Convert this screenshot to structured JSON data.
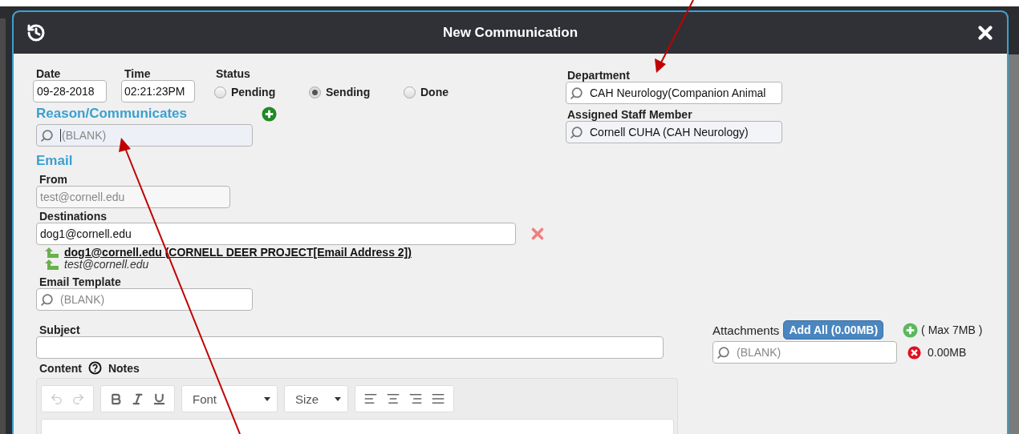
{
  "dialog": {
    "title": "New Communication"
  },
  "date": {
    "label": "Date",
    "value": "09-28-2018"
  },
  "time": {
    "label": "Time",
    "value": "02:21:23PM"
  },
  "status": {
    "label": "Status",
    "options": [
      {
        "label": "Pending",
        "selected": false
      },
      {
        "label": "Sending",
        "selected": true
      },
      {
        "label": "Done",
        "selected": false
      }
    ]
  },
  "reason": {
    "heading": "Reason/Communicates",
    "placeholder": "(BLANK)",
    "focused": true
  },
  "email": {
    "heading": "Email",
    "from": {
      "label": "From",
      "value": "test@cornell.edu",
      "disabled": true
    },
    "destinations": {
      "label": "Destinations",
      "value": "dog1@cornell.edu",
      "suggestions": [
        {
          "text": "dog1@cornell.edu (CORNELL DEER PROJECT[Email Address 2])",
          "kind": "link"
        },
        {
          "text": "test@cornell.edu",
          "kind": "plain"
        }
      ]
    },
    "template": {
      "label": "Email Template",
      "placeholder": "(BLANK)"
    }
  },
  "department": {
    "label": "Department",
    "value": "CAH Neurology(Companion Animal"
  },
  "staff": {
    "label": "Assigned Staff Member",
    "value": "Cornell CUHA (CAH Neurology)"
  },
  "subject": {
    "label": "Subject"
  },
  "content": {
    "label": "Content",
    "notes": "Notes",
    "font": "Font",
    "size": "Size",
    "undo_disabled": true
  },
  "attachments": {
    "label": "Attachments",
    "add_all": "Add All (0.00MB)",
    "max": "( Max 7MB )",
    "placeholder": "(BLANK)",
    "size": "0.00MB"
  }
}
